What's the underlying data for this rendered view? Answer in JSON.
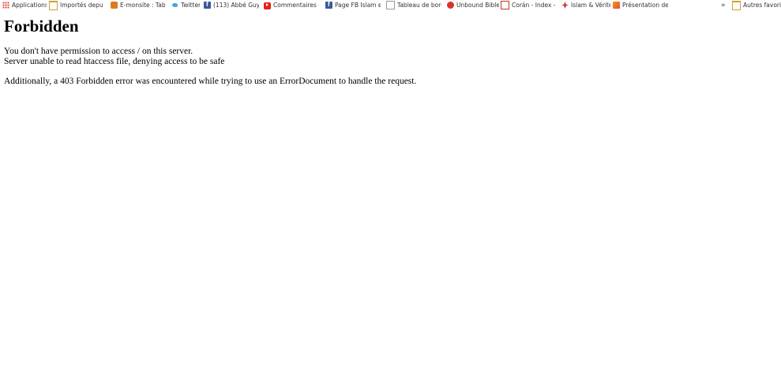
{
  "bookmarks_bar": {
    "items": [
      {
        "label": "Applications",
        "icon": "apps-grid-icon"
      },
      {
        "label": "Importés depuis",
        "icon": "folder-icon"
      },
      {
        "label": "E-monsite : Table",
        "icon": "emonsite-icon"
      },
      {
        "label": "Twitter",
        "icon": "twitter-icon"
      },
      {
        "label": "(113) Abbé Guy P",
        "icon": "facebook-icon"
      },
      {
        "label": "Commentaires - ",
        "icon": "youtube-icon"
      },
      {
        "label": "Page FB Islam et",
        "icon": "facebook-icon"
      },
      {
        "label": "Tableau de bord",
        "icon": "page-icon"
      },
      {
        "label": "Unbound Bible",
        "icon": "unbound-bible-icon"
      },
      {
        "label": "Corán - Index - l",
        "icon": "coran-icon"
      },
      {
        "label": "Islam & Vérité",
        "icon": "islam-verite-icon"
      },
      {
        "label": "Présentation de l",
        "icon": "presentation-icon"
      }
    ],
    "overflow_chevron": "»",
    "other_bookmarks": {
      "label": "Autres favoris",
      "icon": "folder-icon"
    }
  },
  "page": {
    "title": "Forbidden",
    "line1": "You don't have permission to access / on this server.",
    "line2": "Server unable to read htaccess file, denying access to be safe",
    "line3": "Additionally, a 403 Forbidden error was encountered while trying to use an ErrorDocument to handle the request."
  }
}
